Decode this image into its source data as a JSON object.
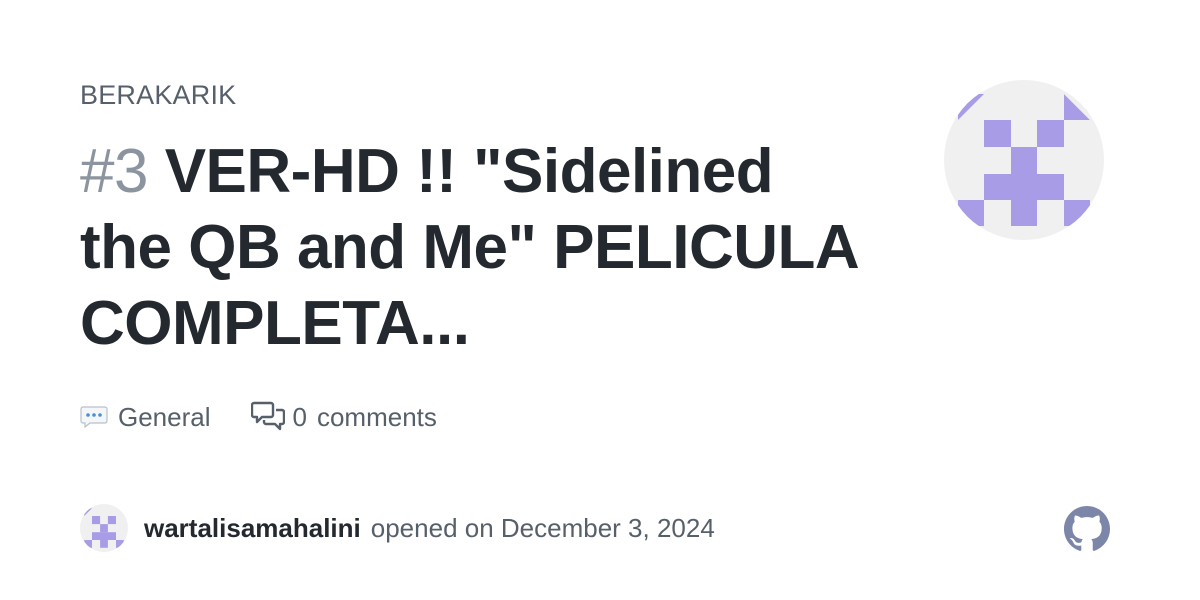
{
  "repo": {
    "name": "BERAKARIK"
  },
  "issue": {
    "number": "#3",
    "title": "VER-HD !! \"Sidelined the QB and Me\" PELICULA COMPLETA..."
  },
  "meta": {
    "category_icon": "speech-bubble-emoji",
    "category": "General",
    "comments_icon": "comment-discussion-icon",
    "comment_count": "0",
    "comments_label": "comments"
  },
  "author": {
    "avatar": "identicon",
    "username": "wartalisamahalini",
    "opened_text": "opened on December 3, 2024"
  },
  "footer": {
    "logo": "github-logo"
  },
  "colors": {
    "identicon": "#a99ce6",
    "identicon_bg": "#f0f0f0",
    "title": "#24292f",
    "muted": "#57606a",
    "issue_number": "#8c959f",
    "github_logo": "#7b86a8"
  }
}
